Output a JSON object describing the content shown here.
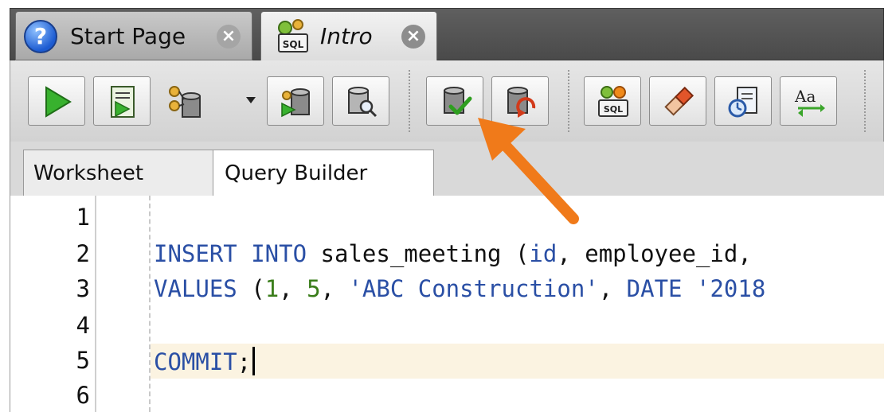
{
  "tabs": [
    {
      "label": "Start Page",
      "icon": "help-icon",
      "active": false
    },
    {
      "label": "Intro",
      "icon": "sql-worksheet-icon",
      "active": true
    }
  ],
  "toolbar": {
    "buttons": [
      {
        "name": "run-statement-button",
        "icon": "play-icon"
      },
      {
        "name": "run-script-button",
        "icon": "script-icon"
      },
      {
        "name": "connection-button",
        "icon": "database-icon"
      },
      {
        "name": "explain-plan-button",
        "icon": "database-arrow-icon"
      },
      {
        "name": "autotrace-button",
        "icon": "database-search-icon"
      },
      {
        "name": "commit-button",
        "icon": "database-check-icon"
      },
      {
        "name": "rollback-button",
        "icon": "database-undo-icon"
      },
      {
        "name": "sql-tuning-button",
        "icon": "sql-gear-icon"
      },
      {
        "name": "clear-button",
        "icon": "eraser-icon"
      },
      {
        "name": "sql-history-button",
        "icon": "history-clock-icon"
      },
      {
        "name": "format-case-button",
        "icon": "case-convert-icon"
      }
    ]
  },
  "subtabs": {
    "worksheet": "Worksheet",
    "query_builder": "Query Builder"
  },
  "editor": {
    "line_numbers": [
      "1",
      "2",
      "3",
      "4",
      "5",
      "6"
    ],
    "line2": {
      "kw1": "INSERT INTO",
      "text1": " sales_meeting (",
      "kw2": "id",
      "text2": ", employee_id,"
    },
    "line3": {
      "kw1": "VALUES",
      "text1": " (",
      "num1": "1",
      "text2": ", ",
      "num2": "5",
      "text3": ", ",
      "str1": "'ABC Construction'",
      "text4": ", ",
      "kw2": "DATE",
      "text5": " ",
      "str2": "'2018"
    },
    "line5": {
      "kw1": "COMMIT",
      "text1": ";"
    }
  },
  "colors": {
    "keyword": "#2a4fa5",
    "number": "#3a7d1a",
    "current_line": "#fbf3e1",
    "annotation_arrow": "#f07a1a"
  }
}
